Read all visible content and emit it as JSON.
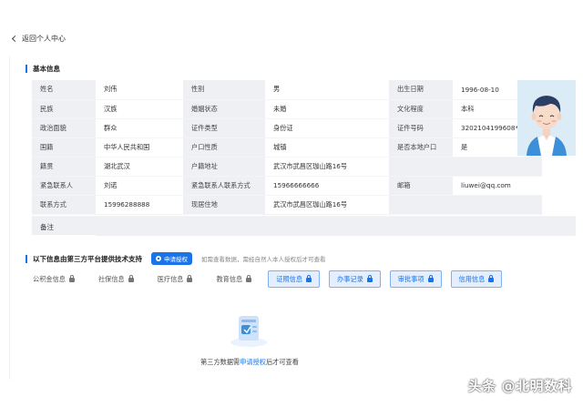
{
  "nav": {
    "back_label": "返回个人中心"
  },
  "basic": {
    "title": "基本信息",
    "rows": [
      [
        {
          "label": "姓名"
        },
        {
          "value": "刘伟"
        },
        {
          "label": "性别"
        },
        {
          "value": "男"
        },
        {
          "label": "出生日期"
        },
        {
          "value": "1996-08-10"
        }
      ],
      [
        {
          "label": "民族"
        },
        {
          "value": "汉族"
        },
        {
          "label": "婚姻状态"
        },
        {
          "value": "未婚"
        },
        {
          "label": "文化程度"
        },
        {
          "value": "本科"
        }
      ],
      [
        {
          "label": "政治面貌"
        },
        {
          "value": "群众"
        },
        {
          "label": "证件类型"
        },
        {
          "value": "身份证"
        },
        {
          "label": "证件号码"
        },
        {
          "value": "3202104199608****26"
        }
      ],
      [
        {
          "label": "国籍"
        },
        {
          "value": "中华人民共和国"
        },
        {
          "label": "户口性质"
        },
        {
          "value": "城镇"
        },
        {
          "label": "是否本地户口"
        },
        {
          "value": "是"
        }
      ],
      [
        {
          "label": "籍贯"
        },
        {
          "value": "湖北武汉"
        },
        {
          "label": "户籍地址"
        },
        {
          "value": "武汉市武昌区珈山路16号"
        },
        {
          "label": ""
        },
        {
          "value": ""
        }
      ],
      [
        {
          "label": "紧急联系人"
        },
        {
          "value": "刘诺"
        },
        {
          "label": "紧急联系人联系方式"
        },
        {
          "value": "15966666666"
        },
        {
          "label": "邮箱"
        },
        {
          "value": "liuwei@qq.com"
        }
      ],
      [
        {
          "label": "联系方式"
        },
        {
          "value": "15996288888"
        },
        {
          "label": "现居住地"
        },
        {
          "value": "武汉市武昌区珈山路16号"
        },
        {
          "label": ""
        },
        {
          "value": ""
        }
      ]
    ],
    "remark_label": "备注"
  },
  "third_party": {
    "title": "以下信息由第三方平台提供技术支持",
    "apply_button": "申请授权",
    "hint": "如需查看数据，需经自然人本人授权后才可查看",
    "tabs": [
      {
        "label": "公积金信息",
        "style": "gray"
      },
      {
        "label": "社保信息",
        "style": "gray"
      },
      {
        "label": "医疗信息",
        "style": "gray"
      },
      {
        "label": "教育信息",
        "style": "gray"
      },
      {
        "label": "证照信息",
        "style": "blue"
      },
      {
        "label": "办事记录",
        "style": "blue"
      },
      {
        "label": "审批事项",
        "style": "blue"
      },
      {
        "label": "信用信息",
        "style": "blue"
      }
    ],
    "empty_prefix": "第三方数据需",
    "empty_link": "申请授权",
    "empty_suffix": "后才可查看"
  },
  "watermark": "头条 @北明数科",
  "colors": {
    "accent": "#1a73e8",
    "label_bg": "#eef0f3",
    "avatar_bg": "#dcecf7"
  }
}
